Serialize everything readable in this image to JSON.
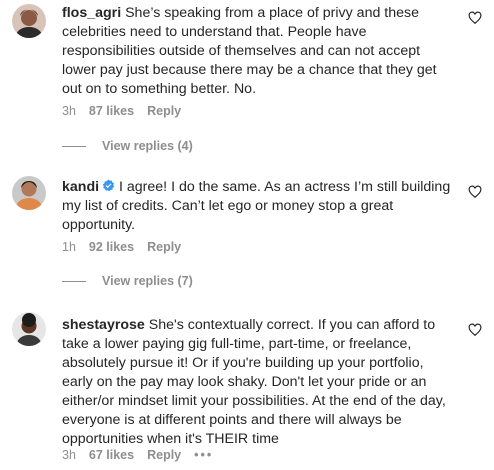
{
  "comments": [
    {
      "username": "flos_agri",
      "verified": false,
      "text": "She’s speaking from a place of privy and these celebrities need to understand that. People have responsibilities outside of themselves and can not accept lower pay just because there may be a chance that they get out on to something better. No.",
      "time": "3h",
      "likes": "87 likes",
      "reply": "Reply",
      "view_replies": "View replies (4)"
    },
    {
      "username": "kandi",
      "verified": true,
      "text": "I agree! I do the same. As an actress I’m still building my list of credits. Can’t let ego or money stop a great opportunity.",
      "time": "1h",
      "likes": "92 likes",
      "reply": "Reply",
      "view_replies": "View replies (7)"
    },
    {
      "username": "shestayrose",
      "verified": false,
      "text": "She's contextually correct. If you can afford to take a lower paying gig full-time, part-time, or freelance, absolutely pursue it! Or if you're building up your portfolio, early on the pay may look shaky. Don't let your pride or an either/or mindset limit your possibilities. At the end of the day, everyone is at different points and there will always be opportunities when it's THEIR time",
      "time": "3h",
      "likes": "67 likes",
      "reply": "Reply",
      "more": "•••"
    }
  ],
  "colors": {
    "text": "#262626",
    "secondary": "#8e8e8e",
    "verified": "#3897f0"
  },
  "icons": {
    "like": "heart-outline-icon",
    "verified": "verified-badge-icon",
    "more": "more-options-icon"
  }
}
